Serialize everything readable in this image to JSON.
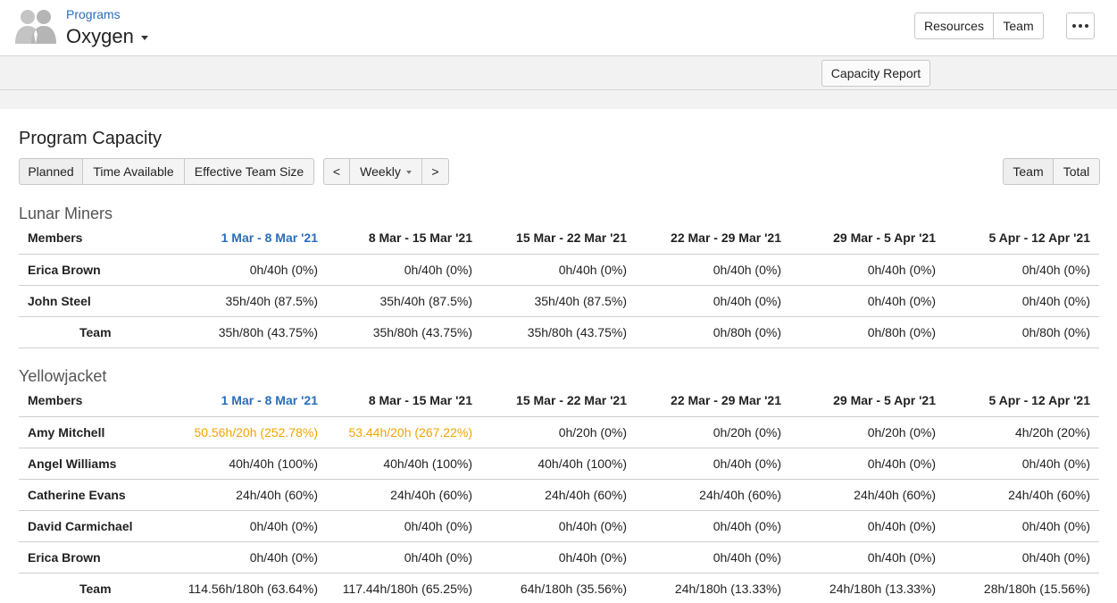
{
  "header": {
    "breadcrumb": "Programs",
    "program_name": "Oxygen",
    "resources_label": "Resources",
    "team_label": "Team"
  },
  "toolbar": {
    "capacity_report_label": "Capacity Report"
  },
  "page": {
    "title": "Program Capacity",
    "metric_tabs": [
      "Planned",
      "Time Available",
      "Effective Team Size"
    ],
    "prev_label": "<",
    "period_label": "Weekly",
    "next_label": ">",
    "view_tabs": [
      "Team",
      "Total"
    ]
  },
  "columns": {
    "members_label": "Members",
    "periods": [
      "1 Mar - 8 Mar '21",
      "8 Mar - 15 Mar '21",
      "15 Mar - 22 Mar '21",
      "22 Mar - 29 Mar '21",
      "29 Mar - 5 Apr '21",
      "5 Apr - 12 Apr '21"
    ]
  },
  "teams": [
    {
      "name": "Lunar Miners",
      "members": [
        {
          "name": "Erica Brown",
          "values": [
            "0h/40h (0%)",
            "0h/40h (0%)",
            "0h/40h (0%)",
            "0h/40h (0%)",
            "0h/40h (0%)",
            "0h/40h (0%)"
          ]
        },
        {
          "name": "John Steel",
          "values": [
            "35h/40h (87.5%)",
            "35h/40h (87.5%)",
            "35h/40h (87.5%)",
            "0h/40h (0%)",
            "0h/40h (0%)",
            "0h/40h (0%)"
          ]
        }
      ],
      "total_label": "Team",
      "totals": [
        "35h/80h (43.75%)",
        "35h/80h (43.75%)",
        "35h/80h (43.75%)",
        "0h/80h (0%)",
        "0h/80h (0%)",
        "0h/80h (0%)"
      ]
    },
    {
      "name": "Yellowjacket",
      "members": [
        {
          "name": "Amy Mitchell",
          "values": [
            "50.56h/20h (252.78%)",
            "53.44h/20h (267.22%)",
            "0h/20h (0%)",
            "0h/20h (0%)",
            "0h/20h (0%)",
            "4h/20h (20%)"
          ]
        },
        {
          "name": "Angel Williams",
          "values": [
            "40h/40h (100%)",
            "40h/40h (100%)",
            "40h/40h (100%)",
            "0h/40h (0%)",
            "0h/40h (0%)",
            "0h/40h (0%)"
          ]
        },
        {
          "name": "Catherine Evans",
          "values": [
            "24h/40h (60%)",
            "24h/40h (60%)",
            "24h/40h (60%)",
            "24h/40h (60%)",
            "24h/40h (60%)",
            "24h/40h (60%)"
          ]
        },
        {
          "name": "David Carmichael",
          "values": [
            "0h/40h (0%)",
            "0h/40h (0%)",
            "0h/40h (0%)",
            "0h/40h (0%)",
            "0h/40h (0%)",
            "0h/40h (0%)"
          ]
        },
        {
          "name": "Erica Brown",
          "values": [
            "0h/40h (0%)",
            "0h/40h (0%)",
            "0h/40h (0%)",
            "0h/40h (0%)",
            "0h/40h (0%)",
            "0h/40h (0%)"
          ]
        }
      ],
      "total_label": "Team",
      "totals": [
        "114.56h/180h (63.64%)",
        "117.44h/180h (65.25%)",
        "64h/180h (35.56%)",
        "24h/180h (13.33%)",
        "24h/180h (13.33%)",
        "28h/180h (15.56%)"
      ]
    }
  ],
  "colors": {
    "link": "#2a6ebb",
    "over_capacity": "#f0a500"
  }
}
